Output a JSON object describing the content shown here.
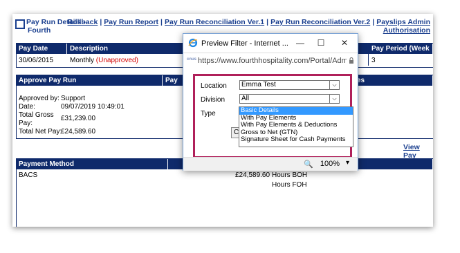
{
  "header": {
    "title_line1": "Pay Run Details -",
    "title_line2": "Fourth",
    "links": [
      "Rollback",
      "Pay Run Report",
      "Pay Run Reconciliation Ver.1",
      "Pay Run Reconciliation Ver.2",
      "Payslips Admin"
    ],
    "link_line2": "Authorisation"
  },
  "payrun_table": {
    "headers": {
      "pay_date": "Pay Date",
      "description": "Description",
      "pay_period": "Pay Period (Week"
    },
    "row": {
      "pay_date": "30/06/2015",
      "description": "Monthly",
      "status": "(Unapproved)",
      "pay_period": "3"
    }
  },
  "approve": {
    "heading": "Approve Pay Run",
    "heading2": "Pay",
    "heading3": "es",
    "approved_by_label": "Approved by:",
    "approved_by_value": "Support",
    "date_label": "Date:",
    "date_value": "09/07/2019 10:49:01",
    "gross_label_1": "Total Gross",
    "gross_label_2": "Pay:",
    "gross_value": "£31,239.00",
    "net_label": "Total Net Pay:",
    "net_value": "£24,589.60"
  },
  "view_link": "View Pay",
  "payment": {
    "heading": "Payment Method",
    "method": "BACS",
    "amount": "£24,589.60",
    "hours_boh": "Hours BOH",
    "hours_foh": "Hours FOH"
  },
  "popup": {
    "title": "Preview Filter - Internet ...",
    "url": "https://www.fourthhospitality.com/Portal/Admi",
    "url_badge": "cnus",
    "location_label": "Location",
    "location_value": "Emma Test",
    "division_label": "Division",
    "division_value": "All",
    "type_label": "Type",
    "type_options": [
      "Basic Details",
      "With Pay Elements",
      "With Pay Elements & Deductions",
      "Gross to Net (GTN)",
      "Signature Sheet for Cash Payments"
    ],
    "type_selected_index": 0,
    "behind_button": "C",
    "zoom": "100%",
    "minimize": "—",
    "maximize": "☐",
    "close": "✕",
    "zoom_icon": "🔍",
    "caret": "▾"
  },
  "icons": {
    "ie": "ie-icon",
    "lock": "lock-icon",
    "zoom": "zoom-icon"
  },
  "colors": {
    "navy": "#0f2a6b",
    "link": "#1a3f8f",
    "highlight": "#b0205a",
    "selection": "#3399ff",
    "unapproved": "#d40000"
  }
}
